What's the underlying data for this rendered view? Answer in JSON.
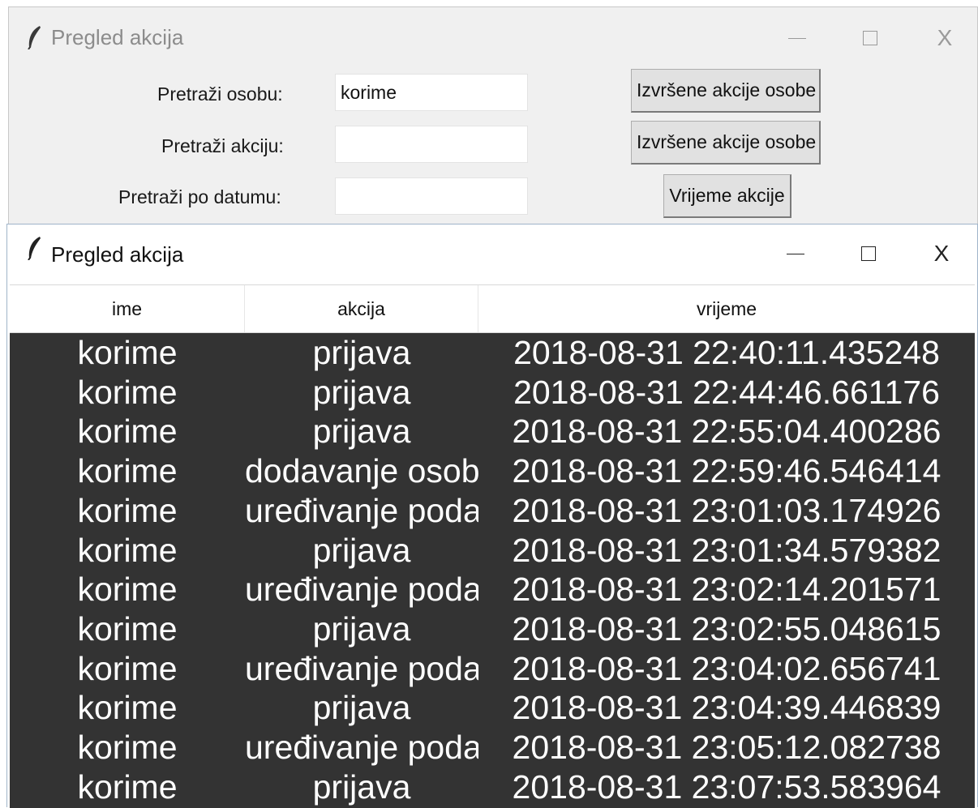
{
  "back_window": {
    "title": "Pregled akcija",
    "labels": {
      "person": "Pretraži osobu:",
      "action": "Pretraži akciju:",
      "date": "Pretraži po datumu:"
    },
    "inputs": {
      "person": "korime",
      "action": "",
      "date": ""
    },
    "buttons": {
      "person": "Izvršene akcije osobe",
      "action": "Izvršene akcije osobe",
      "date": "Vrijeme akcije"
    },
    "controls": {
      "minimize": "—",
      "maximize": "☐",
      "close": "X"
    }
  },
  "front_window": {
    "title": "Pregled akcija",
    "controls": {
      "minimize": "—",
      "maximize": "☐",
      "close": "X"
    },
    "table": {
      "columns": [
        "ime",
        "akcija",
        "vrijeme"
      ],
      "rows": [
        [
          "korime",
          "prijava",
          "2018-08-31 22:40:11.435248"
        ],
        [
          "korime",
          "prijava",
          "2018-08-31 22:44:46.661176"
        ],
        [
          "korime",
          "prijava",
          "2018-08-31 22:55:04.400286"
        ],
        [
          "korime",
          "dodavanje osobe",
          "2018-08-31 22:59:46.546414"
        ],
        [
          "korime",
          "uređivanje podat",
          "2018-08-31 23:01:03.174926"
        ],
        [
          "korime",
          "prijava",
          "2018-08-31 23:01:34.579382"
        ],
        [
          "korime",
          "uređivanje podat",
          "2018-08-31 23:02:14.201571"
        ],
        [
          "korime",
          "prijava",
          "2018-08-31 23:02:55.048615"
        ],
        [
          "korime",
          "uređivanje podat",
          "2018-08-31 23:04:02.656741"
        ],
        [
          "korime",
          "prijava",
          "2018-08-31 23:04:39.446839"
        ],
        [
          "korime",
          "uređivanje podat",
          "2018-08-31 23:05:12.082738"
        ],
        [
          "korime",
          "prijava",
          "2018-08-31 23:07:53.583964"
        ]
      ]
    }
  },
  "colors": {
    "table_background": "#333333",
    "table_text": "#ffffff",
    "window_background": "#f0f0f0"
  },
  "icons": {
    "app": "feather-icon",
    "minimize": "minimize-icon",
    "maximize": "maximize-icon",
    "close": "close-icon"
  }
}
